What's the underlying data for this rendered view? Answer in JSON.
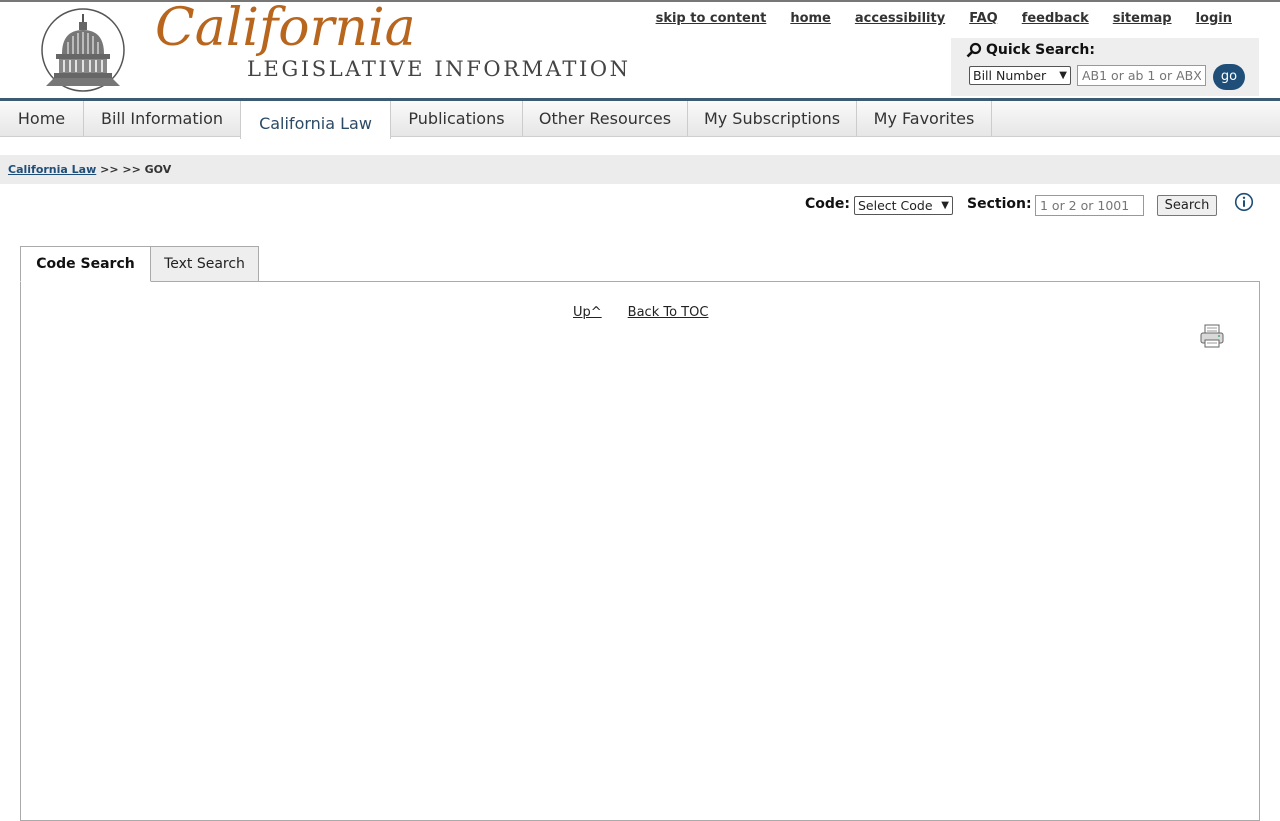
{
  "header": {
    "logo_script": "California",
    "logo_subtitle": "LEGISLATIVE INFORMATION",
    "utility_links": [
      "skip to content",
      "home",
      "accessibility",
      "FAQ",
      "feedback",
      "sitemap",
      "login"
    ]
  },
  "quick_search": {
    "title": "Quick Search:",
    "type_selected": "Bill Number",
    "placeholder": "AB1 or ab 1 or ABX1",
    "go_label": "go"
  },
  "nav": {
    "items": [
      "Home",
      "Bill Information",
      "California Law",
      "Publications",
      "Other Resources",
      "My Subscriptions",
      "My Favorites"
    ],
    "active": "California Law"
  },
  "breadcrumb": {
    "link": "California Law",
    "rest": ">> >> GOV"
  },
  "code_search": {
    "code_label": "Code:",
    "code_selected": "Select Code",
    "section_label": "Section:",
    "section_placeholder": "1 or 2 or 1001",
    "search_label": "Search"
  },
  "tabs": {
    "code_search": "Code Search",
    "text_search": "Text Search"
  },
  "panel": {
    "up_link": "Up^",
    "toc_link": "Back To TOC"
  },
  "colors": {
    "brand_orange": "#b8651d",
    "nav_blue": "#1f4e79"
  }
}
